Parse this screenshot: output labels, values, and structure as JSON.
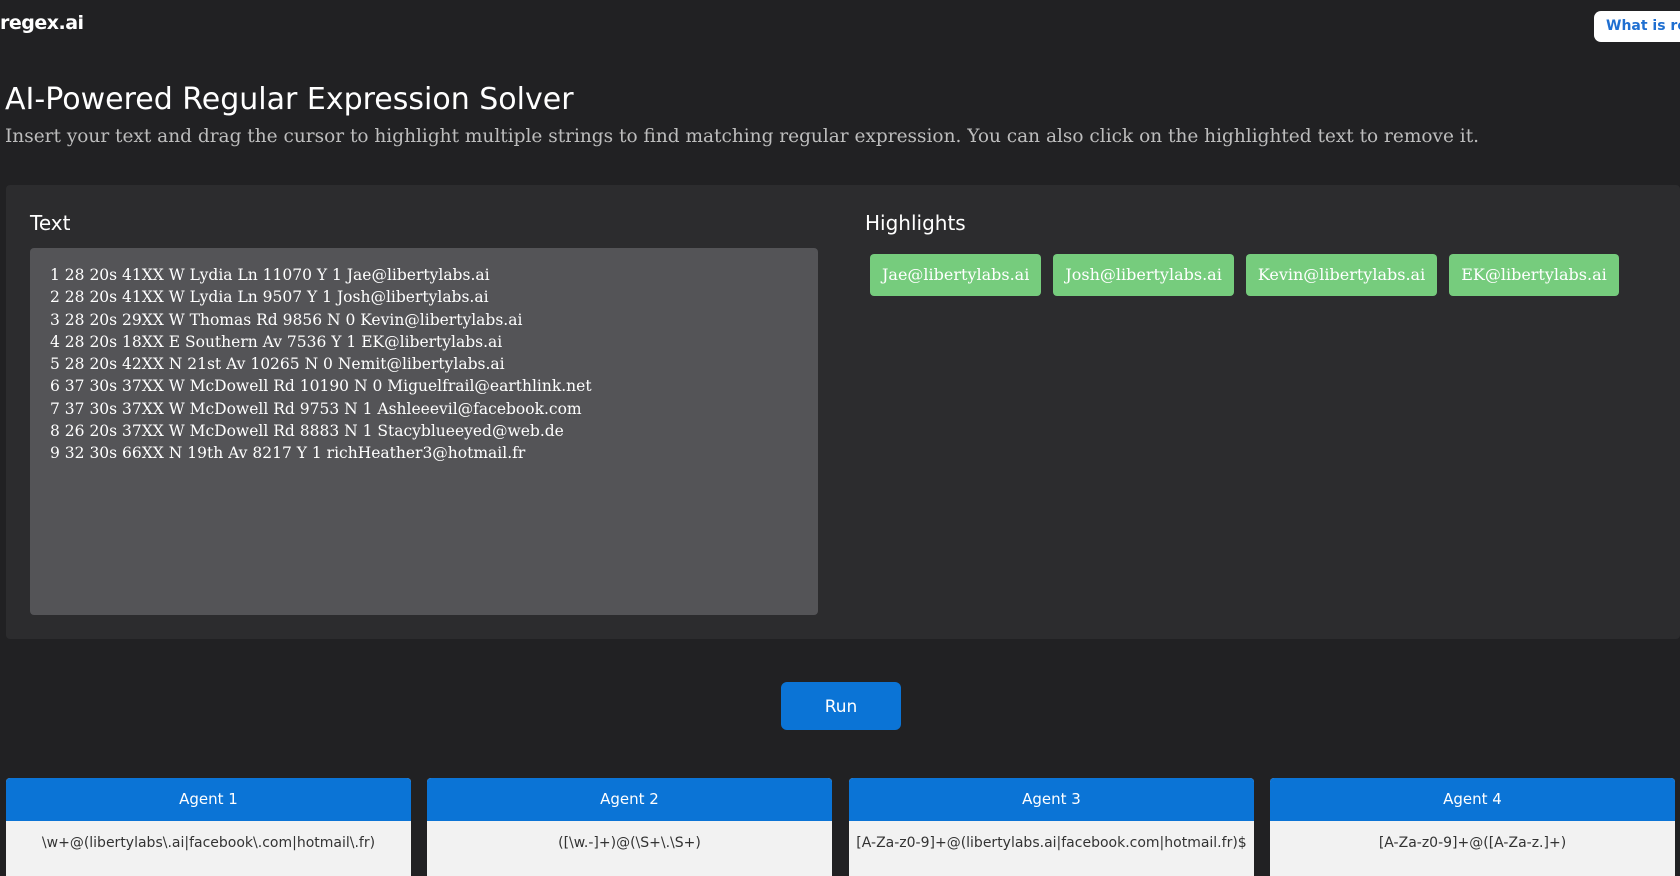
{
  "header": {
    "logo": "regex.ai",
    "what_button_label": "What is reg"
  },
  "main": {
    "title": "AI-Powered Regular Expression Solver",
    "subtitle": "Insert your text and drag the cursor to highlight multiple strings to find matching regular expression. You can also click on the highlighted text to remove it."
  },
  "editor": {
    "text_label": "Text",
    "highlights_label": "Highlights",
    "lines": [
      "1 28 20s 41XX W Lydia Ln 11070 Y 1 Jae@libertylabs.ai",
      "2 28 20s 41XX W Lydia Ln 9507 Y 1 Josh@libertylabs.ai",
      "3 28 20s 29XX W Thomas Rd 9856 N 0 Kevin@libertylabs.ai",
      "4 28 20s 18XX E Southern Av 7536 Y 1 EK@libertylabs.ai",
      "5 28 20s 42XX N 21st Av 10265 N 0 Nemit@libertylabs.ai",
      "6 37 30s 37XX W McDowell Rd 10190 N 0 Miguelfrail@earthlink.net",
      "7 37 30s 37XX W McDowell Rd 9753 N 1 Ashleeevil@facebook.com",
      "8 26 20s 37XX W McDowell Rd 8883 N 1 Stacyblueeyed@web.de",
      "9 32 30s 66XX N 19th Av 8217 Y 1 richHeather3@hotmail.fr"
    ],
    "highlights": [
      "Jae@libertylabs.ai",
      "Josh@libertylabs.ai",
      "Kevin@libertylabs.ai",
      "EK@libertylabs.ai"
    ],
    "highlight_color": "#76cc7d"
  },
  "run_button_label": "Run",
  "accent_color": "#0b74d6",
  "agents": [
    {
      "name": "Agent 1",
      "regex": "\\w+@(libertylabs\\.ai|facebook\\.com|hotmail\\.fr)"
    },
    {
      "name": "Agent 2",
      "regex": "([\\w.-]+)@(\\S+\\.\\S+)"
    },
    {
      "name": "Agent 3",
      "regex": "[A-Za-z0-9]+@(libertylabs.ai|facebook.com|hotmail.fr)$"
    },
    {
      "name": "Agent 4",
      "regex": "[A-Za-z0-9]+@([A-Za-z.]+)"
    }
  ]
}
